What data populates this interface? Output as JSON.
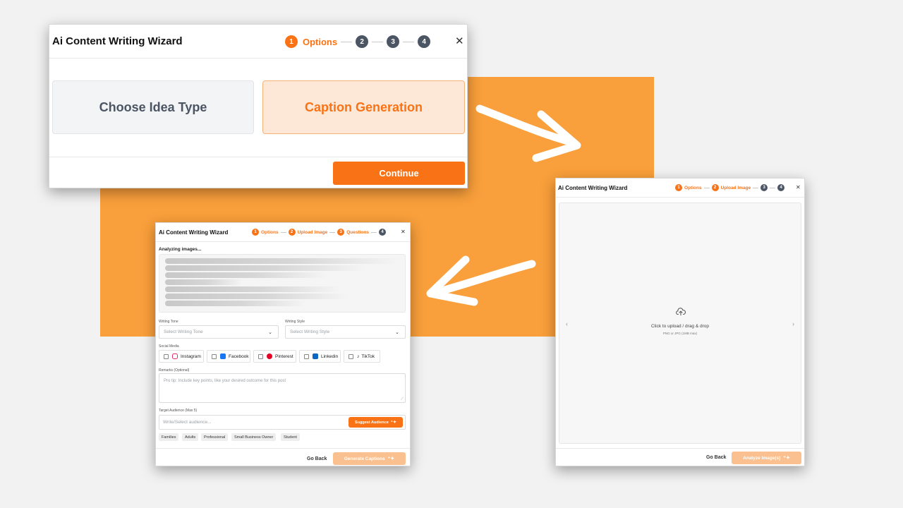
{
  "app_title": "Ai Content Writing Wizard",
  "colors": {
    "accent": "#f97316",
    "background_block": "#f99f3b"
  },
  "icons": {
    "close": "close-icon",
    "upload": "upload-cloud-icon",
    "sparkle": "sparkle-icon"
  },
  "panel1": {
    "steps": [
      {
        "num": "1",
        "label": "Options"
      },
      {
        "num": "2",
        "label": ""
      },
      {
        "num": "3",
        "label": ""
      },
      {
        "num": "4",
        "label": ""
      }
    ],
    "close": "✕",
    "option_left": "Choose Idea Type",
    "option_right": "Caption Generation",
    "continue": "Continue"
  },
  "panel2": {
    "steps": [
      {
        "num": "1",
        "label": "Options"
      },
      {
        "num": "2",
        "label": "Upload Image"
      },
      {
        "num": "3",
        "label": ""
      },
      {
        "num": "4",
        "label": ""
      }
    ],
    "close": "✕",
    "prev": "‹",
    "next": "›",
    "upload_text": "Click to upload / drag & drop",
    "upload_hint": "PNG or JPG (1MB max)",
    "go_back": "Go Back",
    "analyze": "Analyze Image(s)"
  },
  "panel3": {
    "steps": [
      {
        "num": "1",
        "label": "Options"
      },
      {
        "num": "2",
        "label": "Upload Image"
      },
      {
        "num": "3",
        "label": "Questions"
      },
      {
        "num": "4",
        "label": ""
      }
    ],
    "close": "✕",
    "analyzing": "Analyzing images...",
    "writing_tone_label": "Writing Tone",
    "writing_tone_placeholder": "Select Writing Tone",
    "writing_style_label": "Writing Style",
    "writing_style_placeholder": "Select Writing Style",
    "social_media_label": "Social Media",
    "social": [
      "Instagram",
      "Facebook",
      "Pinterest",
      "Linkedin",
      "TikTok"
    ],
    "remarks_label": "Remarks (Optional)",
    "remarks_placeholder": "Pro tip: Include key points, like your desired outcome for this post",
    "audience_label": "Target Audience (Max 5)",
    "audience_placeholder": "Write/Select audience...",
    "suggest": "Suggest Audience",
    "tags": [
      "Families",
      "Adults",
      "Professional",
      "Small Business Owner",
      "Student"
    ],
    "go_back": "Go Back",
    "generate": "Generate Captions"
  }
}
